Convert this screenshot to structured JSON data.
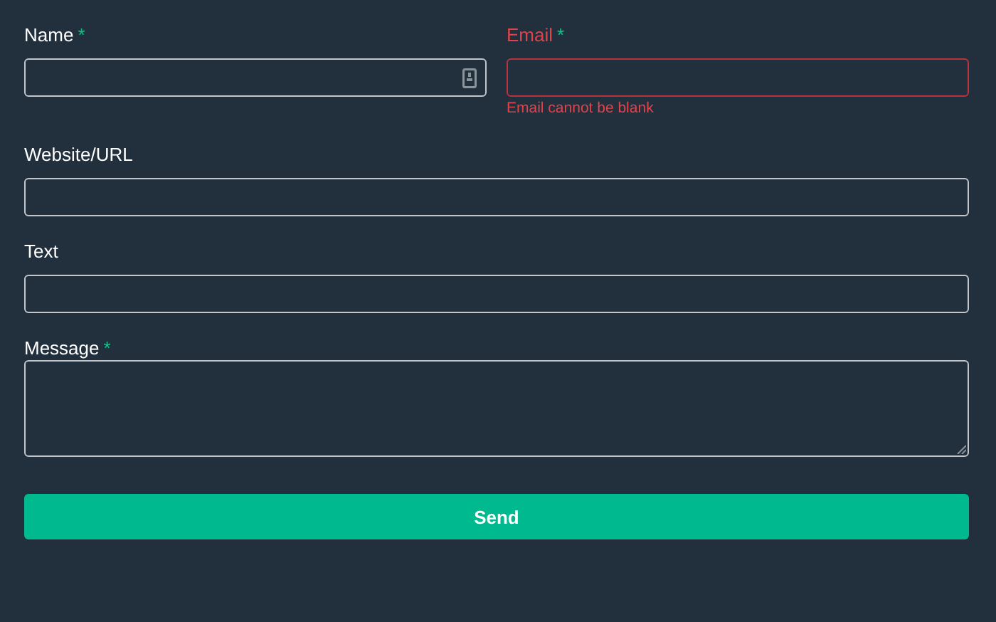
{
  "rows": [
    [
      {
        "label": "Name",
        "required": true,
        "kind": "input",
        "autofill_icon": true,
        "invalid": false
      },
      {
        "label": "Email",
        "required": true,
        "kind": "input",
        "autofill_icon": false,
        "invalid": true,
        "error": "Email cannot be blank"
      }
    ],
    [
      {
        "label": "Website/URL",
        "required": false,
        "kind": "input",
        "autofill_icon": false,
        "invalid": false
      }
    ],
    [
      {
        "label": "Text",
        "required": false,
        "kind": "input",
        "autofill_icon": false,
        "invalid": false
      }
    ],
    [
      {
        "label": "Message",
        "required": true,
        "kind": "textarea",
        "invalid": false
      }
    ]
  ],
  "required_mark": "*",
  "submit": {
    "label": "Send"
  }
}
